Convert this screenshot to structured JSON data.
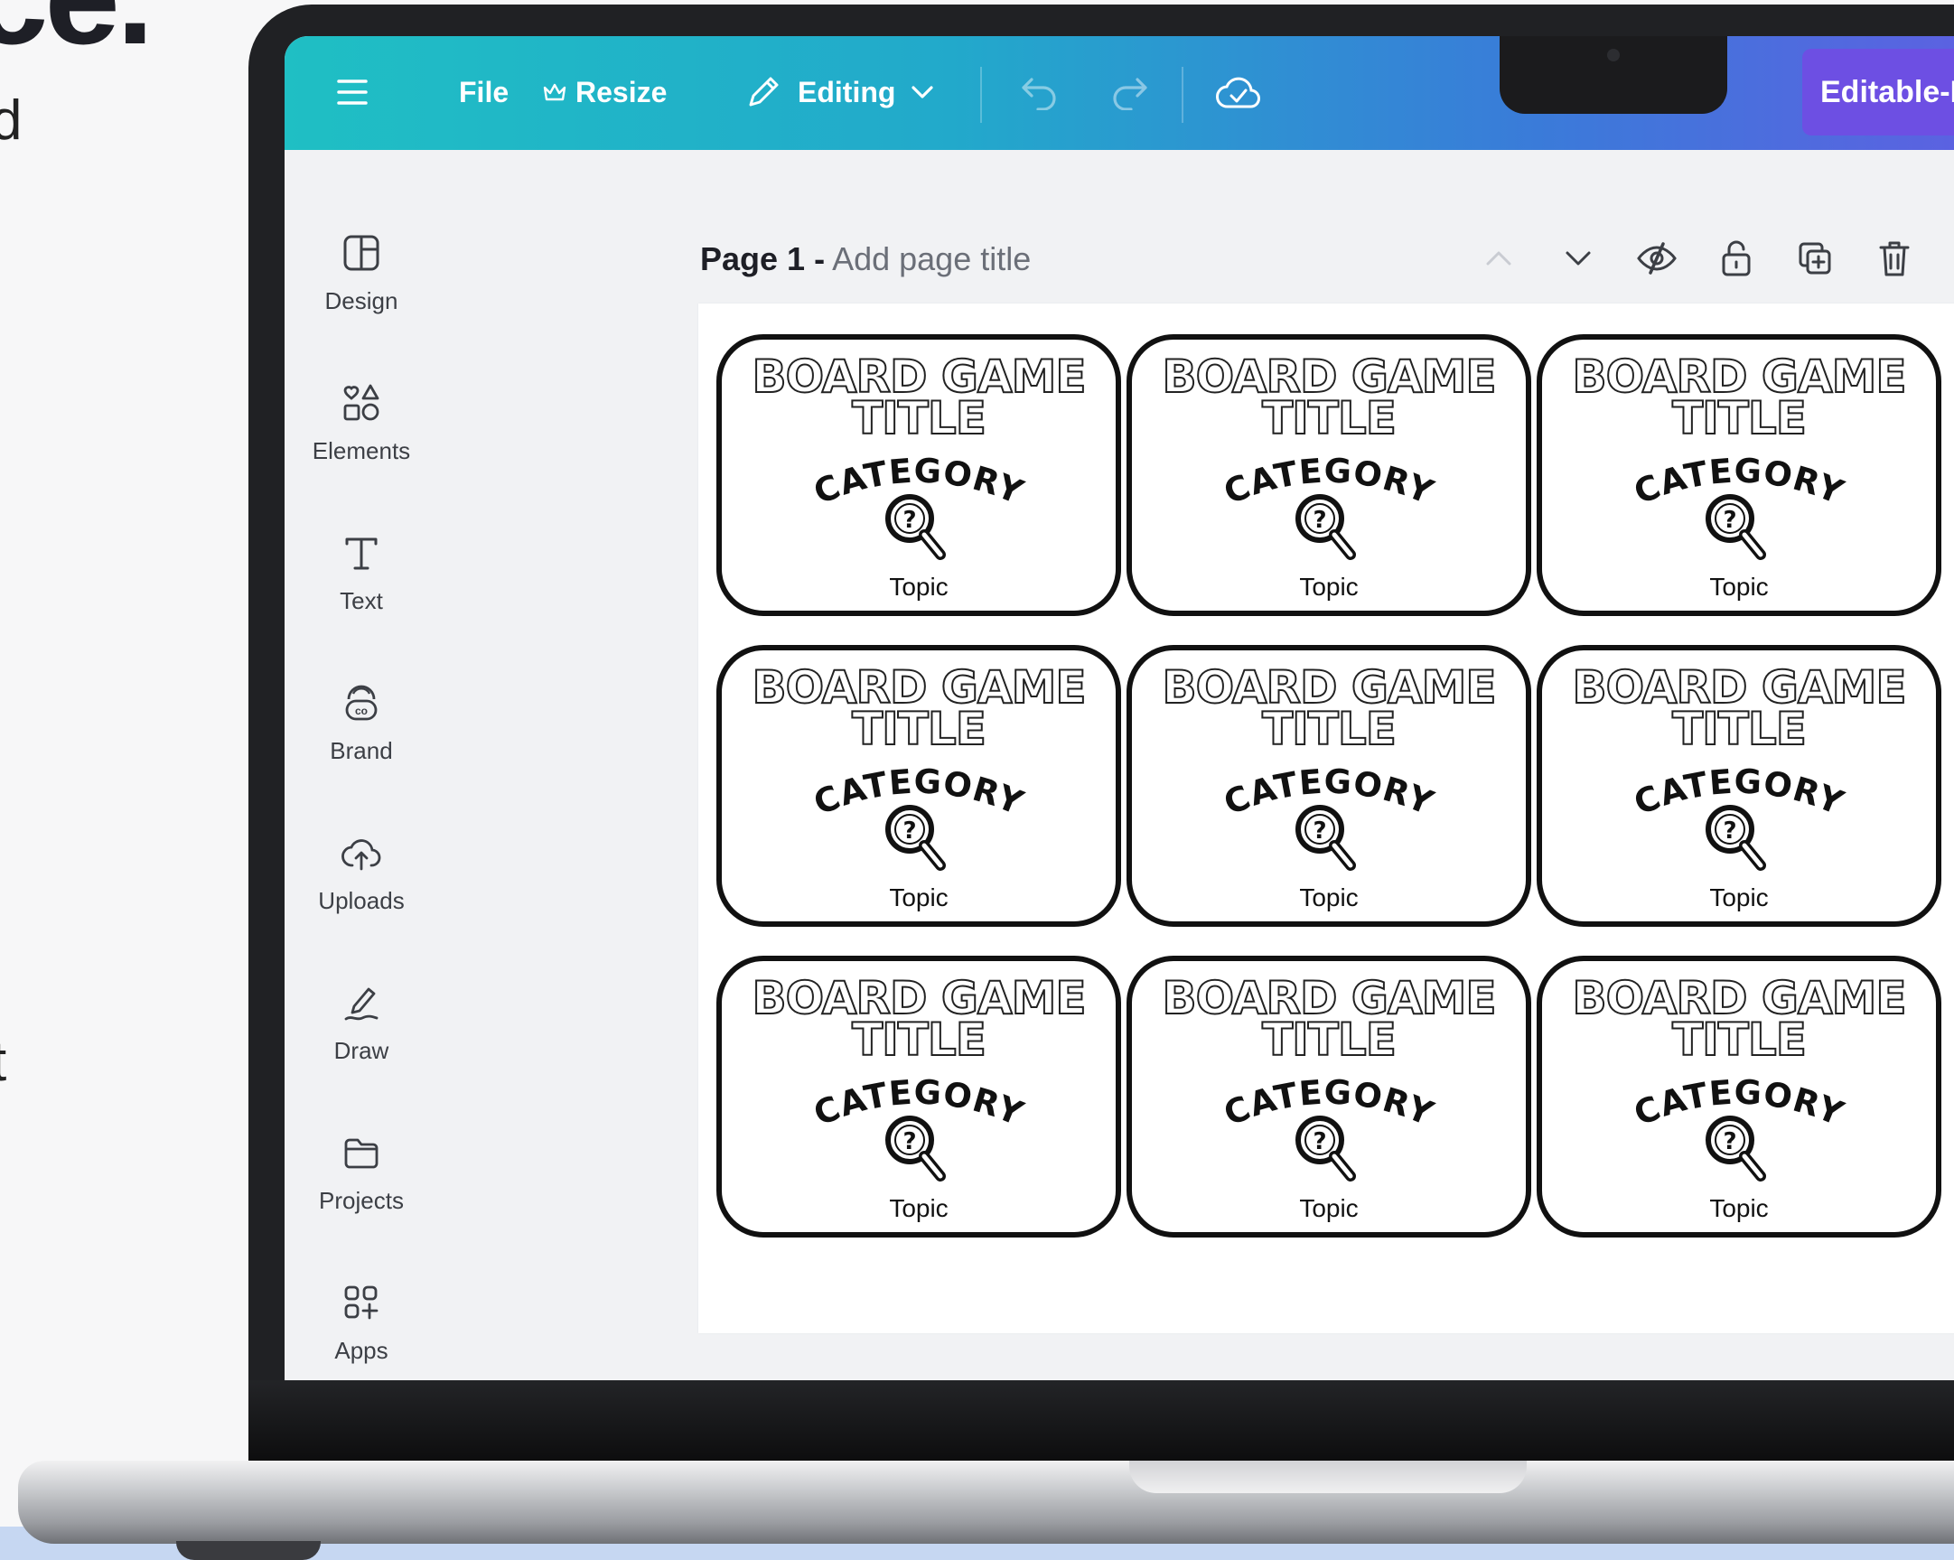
{
  "page_edge": {
    "heading": "ce.",
    "line1": "d",
    "line2": "t"
  },
  "topbar": {
    "file": "File",
    "resize": "Resize",
    "editing": "Editing",
    "cta": "Editable-B"
  },
  "sidebar": {
    "items": [
      {
        "label": "Design",
        "icon": "layout-icon"
      },
      {
        "label": "Elements",
        "icon": "shapes-icon"
      },
      {
        "label": "Text",
        "icon": "text-icon"
      },
      {
        "label": "Brand",
        "icon": "brand-icon"
      },
      {
        "label": "Uploads",
        "icon": "cloud-upload-icon"
      },
      {
        "label": "Draw",
        "icon": "pen-icon"
      },
      {
        "label": "Projects",
        "icon": "folder-icon"
      },
      {
        "label": "Apps",
        "icon": "apps-icon"
      }
    ]
  },
  "page_header": {
    "page_number": "Page 1 -",
    "title_placeholder": "Add page title"
  },
  "card": {
    "title_line1": "BOARD GAME",
    "title_line2": "TITLE",
    "category": "CATEGORY",
    "topic": "Topic"
  },
  "cards_count": 9
}
